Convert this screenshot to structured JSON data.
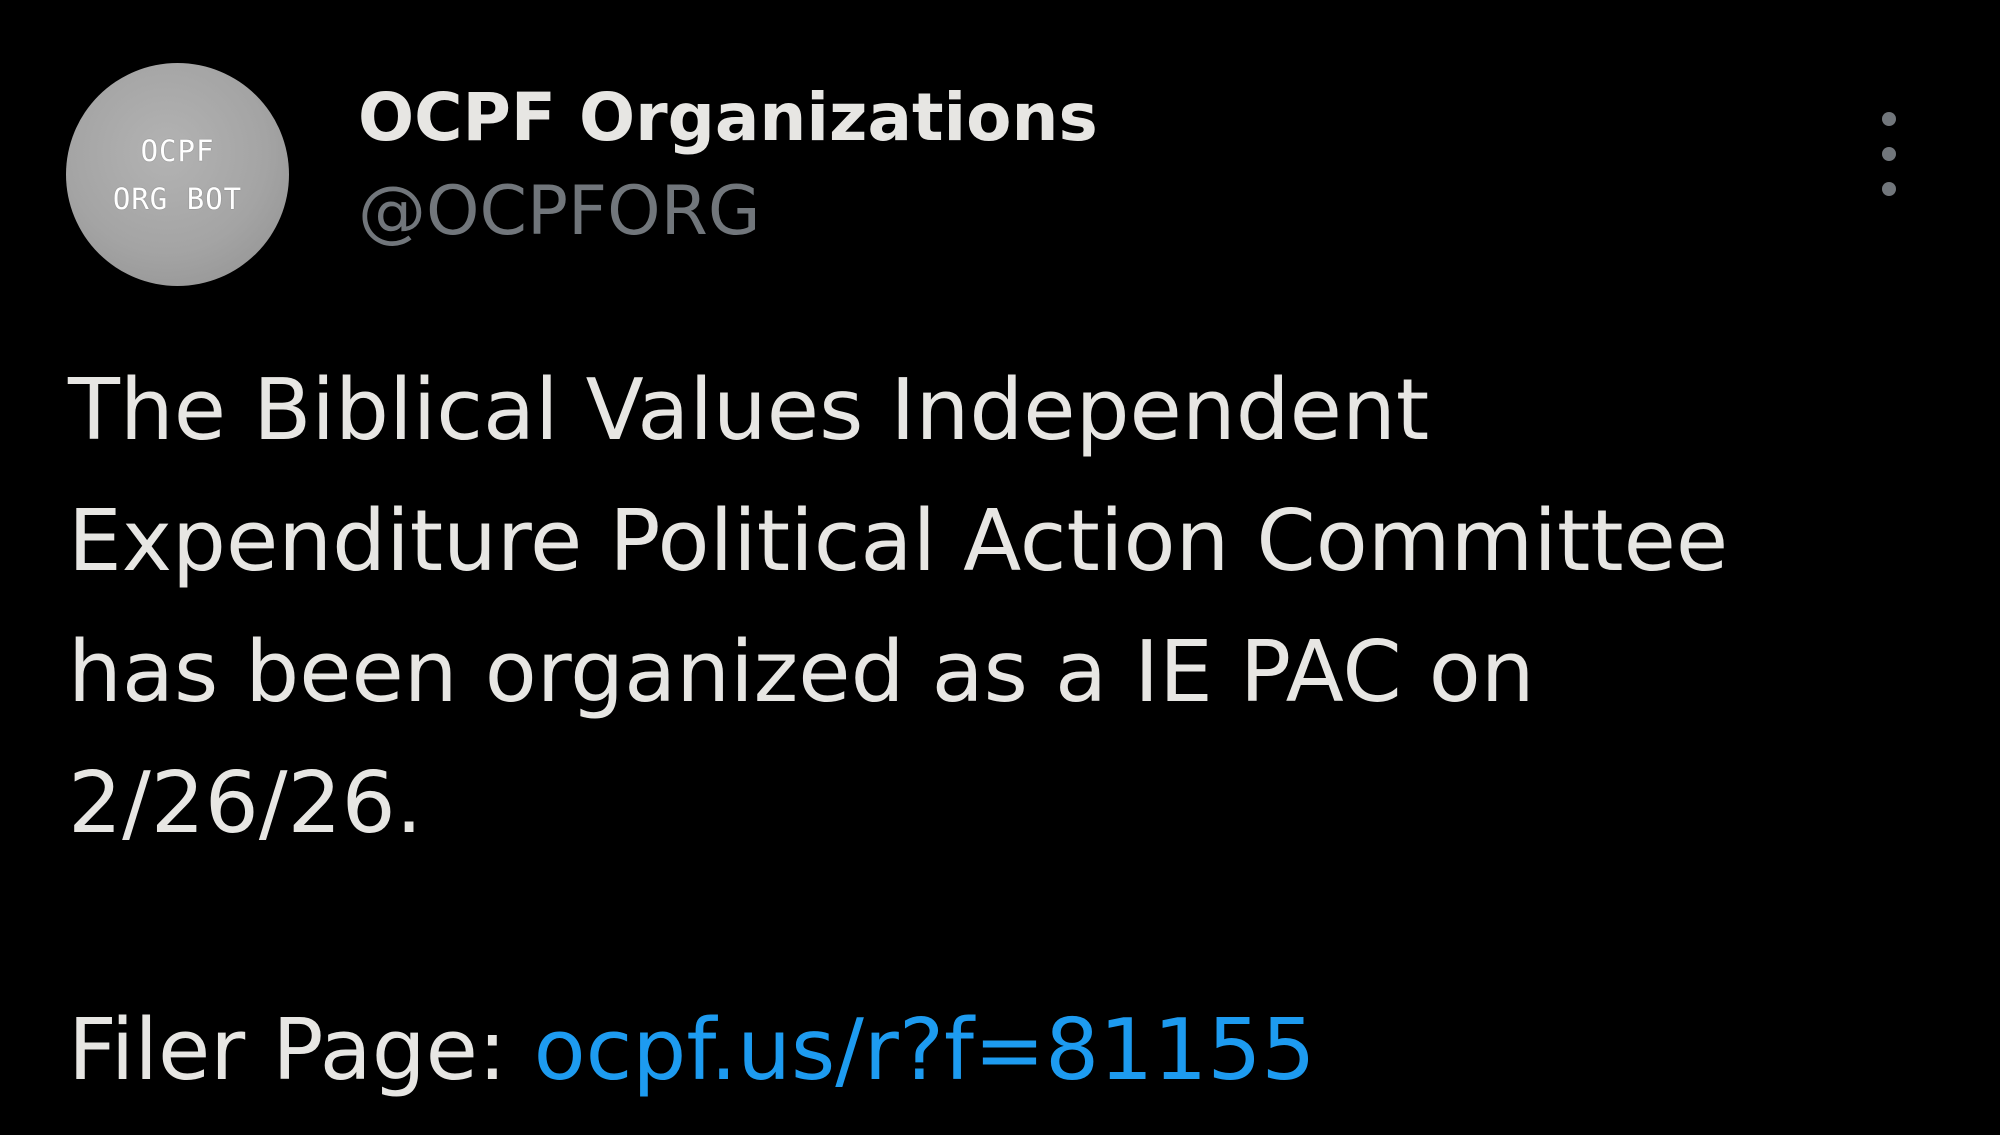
{
  "tweet": {
    "avatar": {
      "line1": "OCPF",
      "line2": "ORG BOT"
    },
    "display_name": "OCPF Organizations",
    "handle": "@OCPFORG",
    "more_icon": "more-vertical-icon",
    "body_lines": [
      "The Biblical Values Independent",
      "Expenditure Political Action Committee",
      "has been organized as a IE PAC on",
      "2/26/26."
    ],
    "filer_label": "Filer Page:",
    "filer_link": "ocpf.us/r?f=81155"
  },
  "colors": {
    "background": "#000000",
    "text": "#e7e6e3",
    "secondary_text": "#71767b",
    "link": "#1d9bf0"
  }
}
